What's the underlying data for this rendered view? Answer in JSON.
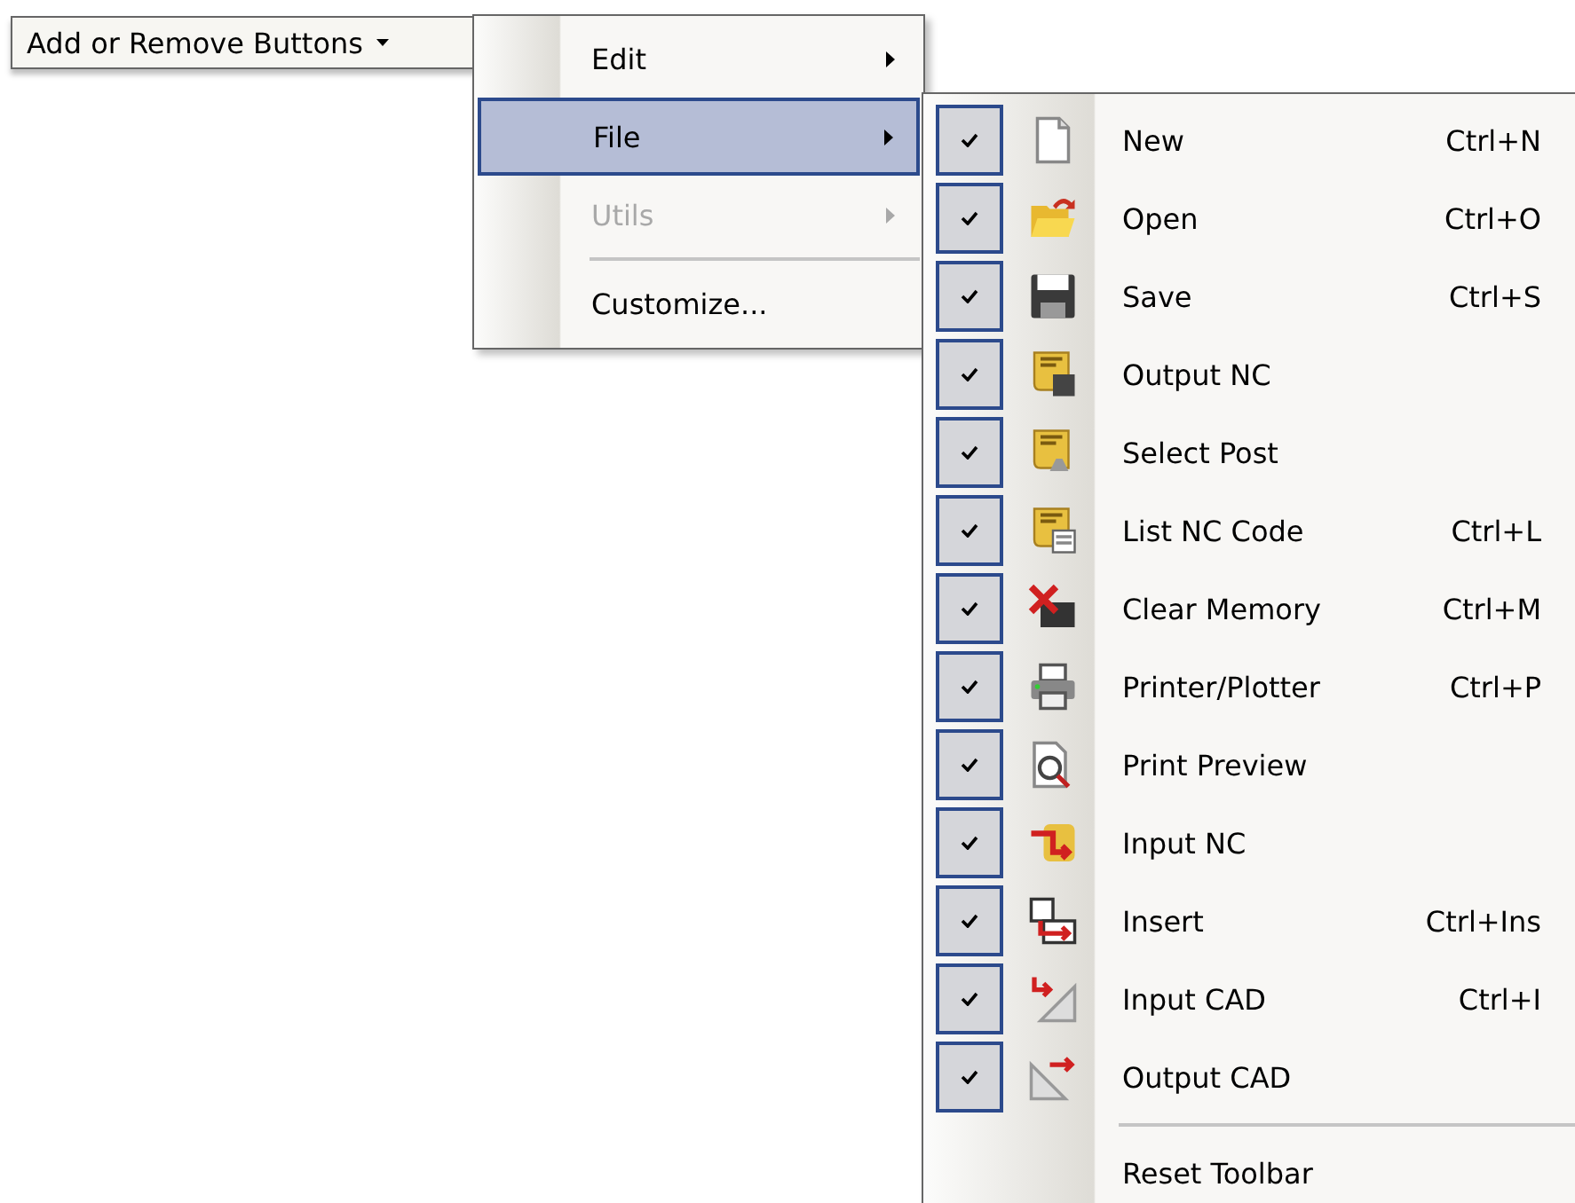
{
  "toolbar_button": {
    "label": "Add or Remove Buttons"
  },
  "menu": {
    "items": [
      {
        "kind": "submenu",
        "label": "Edit",
        "selected": false,
        "disabled": false
      },
      {
        "kind": "submenu",
        "label": "File",
        "selected": true,
        "disabled": false
      },
      {
        "kind": "submenu",
        "label": "Utils",
        "selected": false,
        "disabled": true
      },
      {
        "kind": "separator"
      },
      {
        "kind": "command",
        "label": "Customize...",
        "selected": false,
        "disabled": false
      }
    ]
  },
  "submenu": {
    "items": [
      {
        "kind": "toggle",
        "label": "New",
        "shortcut": "Ctrl+N",
        "checked": true
      },
      {
        "kind": "toggle",
        "label": "Open",
        "shortcut": "Ctrl+O",
        "checked": true
      },
      {
        "kind": "toggle",
        "label": "Save",
        "shortcut": "Ctrl+S",
        "checked": true
      },
      {
        "kind": "toggle",
        "label": "Output NC",
        "checked": true
      },
      {
        "kind": "toggle",
        "label": "Select Post",
        "checked": true
      },
      {
        "kind": "toggle",
        "label": "List NC Code",
        "shortcut": "Ctrl+L",
        "checked": true
      },
      {
        "kind": "toggle",
        "label": "Clear Memory",
        "shortcut": "Ctrl+M",
        "checked": true
      },
      {
        "kind": "toggle",
        "label": "Printer/Plotter",
        "shortcut": "Ctrl+P",
        "checked": true
      },
      {
        "kind": "toggle",
        "label": "Print Preview",
        "checked": true
      },
      {
        "kind": "toggle",
        "label": "Input NC",
        "checked": true
      },
      {
        "kind": "toggle",
        "label": "Insert",
        "shortcut": "Ctrl+Ins",
        "checked": true
      },
      {
        "kind": "toggle",
        "label": "Input CAD",
        "shortcut": "Ctrl+I",
        "checked": true
      },
      {
        "kind": "toggle",
        "label": "Output CAD",
        "checked": true
      },
      {
        "kind": "separator"
      },
      {
        "kind": "command",
        "label": "Reset Toolbar"
      }
    ]
  }
}
